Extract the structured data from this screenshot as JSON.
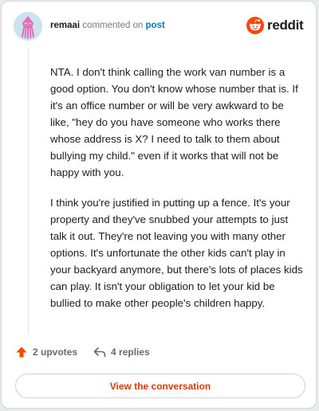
{
  "header": {
    "username": "remaai",
    "commented_on": "commented on",
    "post_link": "post",
    "brand": "reddit"
  },
  "comment": {
    "paragraphs": [
      "NTA. I don't think calling the work van number is a good option. You don't know whose number that is. If it's an office number or will be very awkward to be like, \"hey do you have someone who works there whose address is X? I need to talk to them about bullying my child.\" even if it works that will not be happy with you.",
      "I think you're justified in putting up a fence. It's your property and they've snubbed your attempts to just talk it out. They're not leaving you with many other options. It's unfortunate the other kids can't play in your backyard anymore, but there's lots of places kids can play. It isn't your obligation to let your kid be bullied to make other people's children happy."
    ]
  },
  "actions": {
    "upvotes_label": "2 upvotes",
    "replies_label": "4 replies",
    "upvote_icon": "upvote-arrow-icon",
    "reply_icon": "reply-arrow-icon"
  },
  "cta": {
    "label": "View the conversation"
  },
  "colors": {
    "accent": "#d93a00",
    "upvote": "#ff4500",
    "link": "#0079d3",
    "avatar_bg": "#c9e3f0",
    "avatar_figure": "#e66ab5"
  }
}
